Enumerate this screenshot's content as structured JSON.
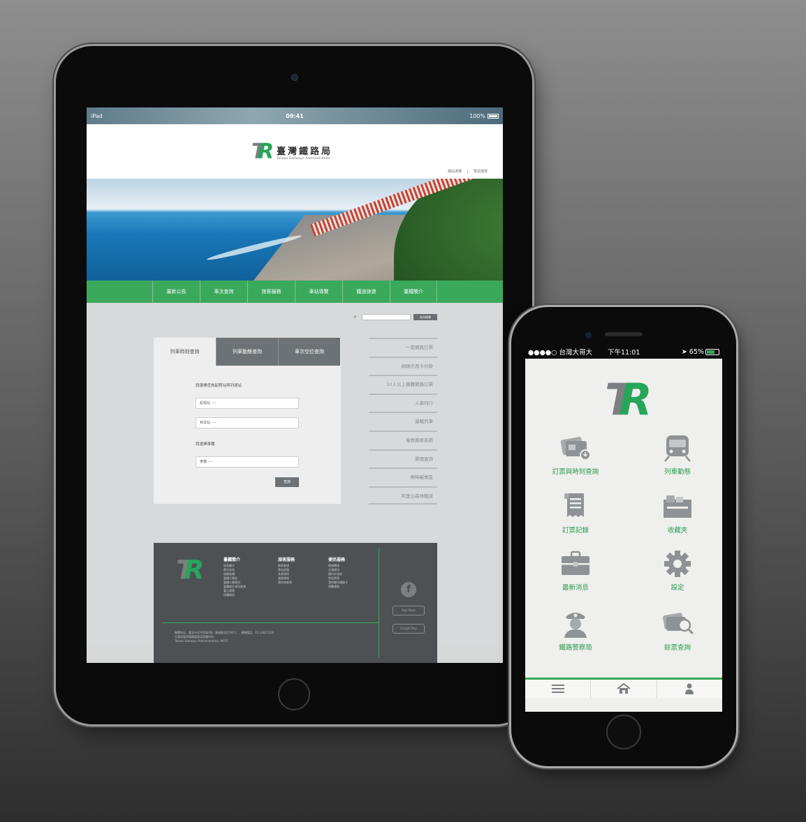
{
  "ipad": {
    "status": {
      "carrier": "iPad",
      "time": "09:41",
      "battery": "100%"
    },
    "site": {
      "name_zh": "臺灣鐵路局",
      "name_en": "Taiwan Railways Administration",
      "header_links": [
        "網站導覽",
        "雙語選擇"
      ],
      "nav": [
        "最新公告",
        "車次查詢",
        "旅客服務",
        "車站導覽",
        "鐵道旅遊",
        "臺鐵簡介"
      ],
      "search_button": "站內搜尋",
      "tabs": [
        "列車時刻查詢",
        "列車動態查詢",
        "車次空位查詢"
      ],
      "form": {
        "prompt_stations": "請選擇查詢起程站與到達站",
        "from_placeholder": "起程站 ----",
        "to_placeholder": "到達站 ----",
        "prompt_type": "請選擇車種",
        "type_placeholder": "車種 ----",
        "submit": "查詢"
      },
      "side_links": [
        "一般網路訂票",
        "網路信用卡付款",
        "10人以上團體網路訂票",
        "人車同行",
        "過輪列車",
        "會員服務系統",
        "票價查詢",
        "無障礙專區",
        "阿里山森林鐵道"
      ],
      "footer": {
        "col1_title": "臺鐵簡介",
        "col1": [
          "局長簡介",
          "歷任局長",
          "組織架構",
          "臺鐵大事紀",
          "臺鐵公開資訊",
          "臺鐵統計資訊查詢",
          "重大政策",
          "採購資訊"
        ],
        "col2_title": "旅客服務",
        "col2": [
          "票價查詢",
          "車站設施",
          "乘車須知",
          "服務指南",
          "遺失物查詢"
        ],
        "col3_title": "便民服務",
        "col3": [
          "客服專線",
          "交通資訊",
          "國內外旅遊",
          "常見問答",
          "我的觀光鐵路卡",
          "相關連結"
        ],
        "info_line1": "機關地址：臺北市北平西路3號（郵遞區號10041）．總機電話：02-23815226",
        "info_line2": "交通部臺灣鐵路管理局版權所有",
        "info_line3": "Taiwan Railways Administration, MOTC ",
        "facebook": "f",
        "app_store": "App Store",
        "google_play": "Google Play"
      }
    }
  },
  "iphone": {
    "status": {
      "carrier": "●●●●○ 台灣大哥大",
      "time": "下午11:01",
      "battery": "65%"
    },
    "menu": [
      {
        "label": "訂票與時刻查詢",
        "icon": "ticket-icon"
      },
      {
        "label": "列車動態",
        "icon": "train-icon"
      },
      {
        "label": "訂票記錄",
        "icon": "receipt-icon"
      },
      {
        "label": "收藏夾",
        "icon": "folder-icon"
      },
      {
        "label": "最新消息",
        "icon": "briefcase-icon"
      },
      {
        "label": "設定",
        "icon": "gear-icon"
      },
      {
        "label": "鐵路警察局",
        "icon": "police-icon"
      },
      {
        "label": "餘票查詢",
        "icon": "ticket-search-icon"
      }
    ],
    "bottom_tabs": [
      "menu-icon",
      "home-icon",
      "user-icon"
    ]
  },
  "colors": {
    "brand_green": "#3aa95b",
    "logo_gray": "#7b7f82",
    "icon_gray": "#9a9d9f"
  }
}
